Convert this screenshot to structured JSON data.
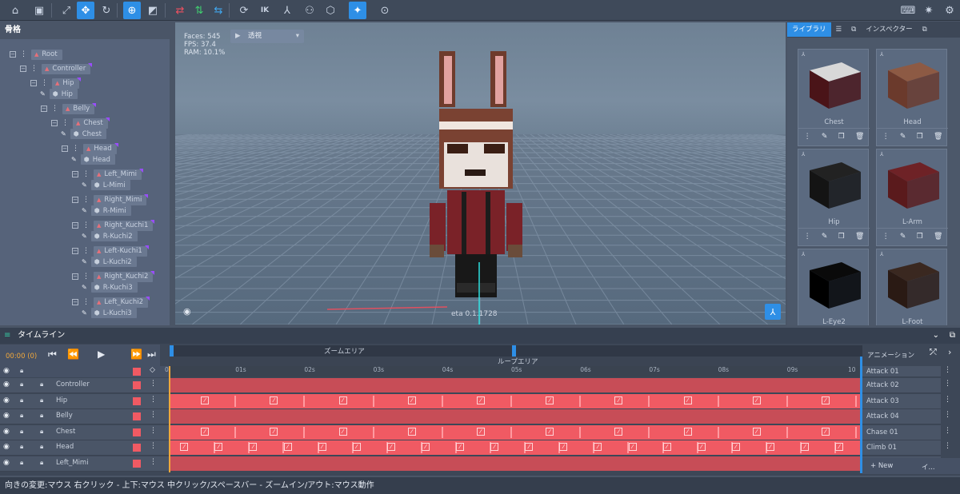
{
  "toolbar": {
    "buttons": [
      {
        "name": "home-icon",
        "glyph": "⌂"
      },
      {
        "name": "save-icon",
        "glyph": "▣"
      },
      {
        "name": "fit-view-icon",
        "glyph": "⤢"
      },
      {
        "name": "move-tool-icon",
        "glyph": "✥",
        "active": true
      },
      {
        "name": "rotate-tool-icon",
        "glyph": "↻"
      },
      {
        "name": "bone-add-icon",
        "glyph": "⊕",
        "active": true
      },
      {
        "name": "bone-mesh-icon",
        "glyph": "◩"
      },
      {
        "name": "swap-red-icon",
        "glyph": "⇄"
      },
      {
        "name": "swap-green-icon",
        "glyph": "⇅"
      },
      {
        "name": "swap-blue-icon",
        "glyph": "⇆"
      },
      {
        "name": "reset-rotate-icon",
        "glyph": "⟳"
      },
      {
        "name": "ik-label",
        "glyph": "IK"
      },
      {
        "name": "axis-icon",
        "glyph": "⅄"
      },
      {
        "name": "hierarchy-icon",
        "glyph": "⚇"
      },
      {
        "name": "cube-outline-icon",
        "glyph": "⬡"
      },
      {
        "name": "sparkle-icon",
        "glyph": "✦",
        "active": true
      },
      {
        "name": "target-icon",
        "glyph": "⊙"
      }
    ],
    "right_buttons": [
      {
        "name": "keyboard-icon",
        "glyph": "⌨"
      },
      {
        "name": "light-icon",
        "glyph": "✷"
      },
      {
        "name": "settings-icon",
        "glyph": "⚙"
      }
    ]
  },
  "skeleton": {
    "title": "骨格",
    "nodes": [
      {
        "label": "Root",
        "type": "bone",
        "indent": 0
      },
      {
        "label": "Controller",
        "type": "bone",
        "indent": 1
      },
      {
        "label": "Hip",
        "type": "bone",
        "indent": 2
      },
      {
        "label": "Hip",
        "type": "mesh",
        "indent": 2
      },
      {
        "label": "Belly",
        "type": "bone",
        "indent": 3
      },
      {
        "label": "Chest",
        "type": "bone",
        "indent": 4
      },
      {
        "label": "Chest",
        "type": "mesh",
        "indent": 4
      },
      {
        "label": "Head",
        "type": "bone",
        "indent": 5
      },
      {
        "label": "Head",
        "type": "mesh",
        "indent": 5
      },
      {
        "label": "Left_Mimi",
        "type": "bone",
        "indent": 6
      },
      {
        "label": "L-Mimi",
        "type": "mesh",
        "indent": 6
      },
      {
        "label": "Right_Mimi",
        "type": "bone",
        "indent": 6
      },
      {
        "label": "R-Mimi",
        "type": "mesh",
        "indent": 6
      },
      {
        "label": "Right_Kuchi1",
        "type": "bone",
        "indent": 6
      },
      {
        "label": "R-Kuchi2",
        "type": "mesh",
        "indent": 6
      },
      {
        "label": "Left-Kuchi1",
        "type": "bone",
        "indent": 6
      },
      {
        "label": "L-Kuchi2",
        "type": "mesh",
        "indent": 6
      },
      {
        "label": "Right_Kuchi2",
        "type": "bone",
        "indent": 6
      },
      {
        "label": "R-Kuchi3",
        "type": "mesh",
        "indent": 6
      },
      {
        "label": "Left_Kuchi2",
        "type": "bone",
        "indent": 6
      },
      {
        "label": "L-Kuchi3",
        "type": "mesh",
        "indent": 6
      }
    ]
  },
  "viewport": {
    "faces": "Faces: 545",
    "fps": "FPS: 37.4",
    "ram": "RAM: 10.1%",
    "view_mode": "透視",
    "meta": "eta 0.1.1728"
  },
  "library": {
    "tabs": [
      "ライブラリ",
      "インスペクター"
    ],
    "items": [
      {
        "label": "Chest",
        "color": "#4a1418",
        "top": "#d8d8d8"
      },
      {
        "label": "Head",
        "color": "#6b3a2c",
        "top": "#8d5a44"
      },
      {
        "label": "Hip",
        "color": "#141414",
        "top": "#222222"
      },
      {
        "label": "L-Arm",
        "color": "#5a1a1c",
        "top": "#6e2226"
      },
      {
        "label": "L-Eye2",
        "color": "#000000",
        "top": "#0a0a0a"
      },
      {
        "label": "L-Foot",
        "color": "#2a1a14",
        "top": "#3a2820"
      }
    ]
  },
  "timeline": {
    "title": "タイムライン",
    "time": "00:00 (0)",
    "zoom_label": "ズームエリア",
    "loop_label": "ループエリア",
    "anim_label": "アニメーション",
    "ticks": [
      "0",
      "01s",
      "02s",
      "03s",
      "04s",
      "05s",
      "06s",
      "07s",
      "08s",
      "09s",
      "10"
    ],
    "rows": [
      {
        "name": "Controller",
        "anim": "Attack 02",
        "keys": [],
        "hl": false
      },
      {
        "name": "Hip",
        "anim": "Attack 03",
        "keys": [
          0.05,
          0.15,
          0.25,
          0.35,
          0.45,
          0.55,
          0.65,
          0.75,
          0.85,
          0.95
        ],
        "hl": true
      },
      {
        "name": "Belly",
        "anim": "Attack 04",
        "keys": [],
        "hl": false
      },
      {
        "name": "Chest",
        "anim": "Chase 01",
        "keys": [
          0.05,
          0.15,
          0.25,
          0.35,
          0.45,
          0.55,
          0.65,
          0.75,
          0.85,
          0.95
        ],
        "hl": true
      },
      {
        "name": "Head",
        "anim": "Climb 01",
        "keys": [
          0.02,
          0.07,
          0.12,
          0.17,
          0.22,
          0.27,
          0.32,
          0.37,
          0.42,
          0.47,
          0.52,
          0.57,
          0.62,
          0.67,
          0.72,
          0.77,
          0.82,
          0.87,
          0.92,
          0.97
        ],
        "hl": true
      },
      {
        "name": "Left_Mimi",
        "anim": "",
        "keys": [],
        "hl": false
      }
    ],
    "anim_first": "Attack 01",
    "new_label": "+ New",
    "import_label": "イ..."
  },
  "status": "向きの変更:マウス 右クリック - 上下:マウス 中クリック/スペースバー - ズームイン/アウト:マウス動作"
}
